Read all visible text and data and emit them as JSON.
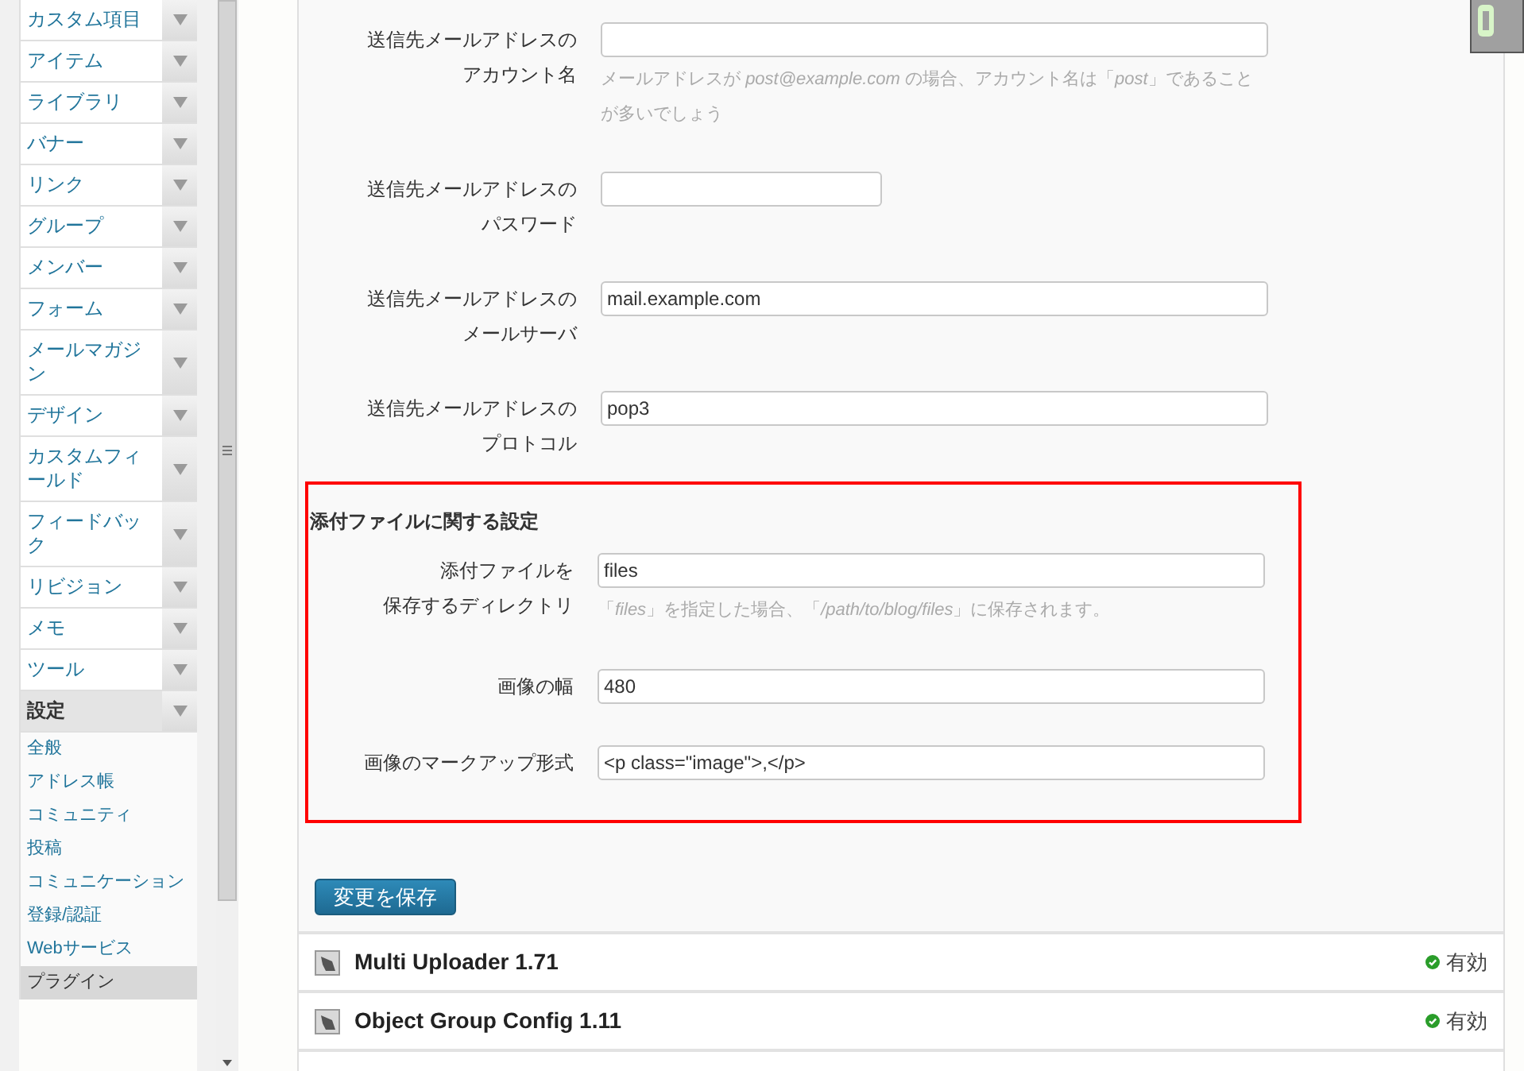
{
  "sidebar": {
    "items": [
      {
        "label": "カスタム項目",
        "expanded": false
      },
      {
        "label": "アイテム",
        "expanded": false
      },
      {
        "label": "ライブラリ",
        "expanded": false
      },
      {
        "label": "バナー",
        "expanded": false
      },
      {
        "label": "リンク",
        "expanded": false
      },
      {
        "label": "グループ",
        "expanded": false
      },
      {
        "label": "メンバー",
        "expanded": false
      },
      {
        "label": "フォーム",
        "expanded": false
      },
      {
        "label": "メールマガジン",
        "expanded": false
      },
      {
        "label": "デザイン",
        "expanded": false
      },
      {
        "label": "カスタムフィールド",
        "expanded": false
      },
      {
        "label": "フィードバック",
        "expanded": false
      },
      {
        "label": "リビジョン",
        "expanded": false
      },
      {
        "label": "メモ",
        "expanded": false
      },
      {
        "label": "ツール",
        "expanded": false
      },
      {
        "label": "設定",
        "expanded": true,
        "children": [
          {
            "label": "全般",
            "selected": false
          },
          {
            "label": "アドレス帳",
            "selected": false
          },
          {
            "label": "コミュニティ",
            "selected": false
          },
          {
            "label": "投稿",
            "selected": false
          },
          {
            "label": "コミュニケーション",
            "selected": false
          },
          {
            "label": "登録/認証",
            "selected": false
          },
          {
            "label": "Webサービス",
            "selected": false
          },
          {
            "label": "プラグイン",
            "selected": true
          }
        ]
      }
    ]
  },
  "fields": [
    {
      "label_lines": [
        "送信先メールアドレスの",
        "アカウント名"
      ],
      "kind": "wide",
      "hint": "メールアドレスが *post@example.com* の場合、アカウント名は「*post*」であることが多いでしょう"
    },
    {
      "label_lines": [
        "送信先メールアドレスの",
        "パスワード"
      ],
      "kind": "short"
    },
    {
      "label_lines": [
        "送信先メールアドレスの",
        "メールサーバ"
      ],
      "kind": "wide",
      "value": "mail.example.com"
    },
    {
      "label_lines": [
        "送信先メールアドレスの",
        "プロトコル"
      ],
      "kind": "wide",
      "value": "pop3"
    }
  ],
  "attachment_section": {
    "title": "添付ファイルに関する設定",
    "fields": [
      {
        "label_lines": [
          "添付ファイルを",
          "保存するディレクトリ"
        ],
        "kind": "wide",
        "value": "files",
        "hint": "「*files*」を指定した場合、「*/path/to/blog/files*」に保存されます。"
      },
      {
        "label_lines": [
          "画像の幅"
        ],
        "kind": "wide",
        "value": "480"
      },
      {
        "label_lines": [
          "画像のマークアップ形式"
        ],
        "kind": "wide",
        "value": "<p class=\"image\">,</p>"
      }
    ]
  },
  "save_button": "変更を保存",
  "plugins": [
    {
      "name": "Multi Uploader 1.71",
      "status": "有効",
      "enabled": true
    },
    {
      "name": "Object Group Config 1.11",
      "status": "有効",
      "enabled": true
    }
  ]
}
